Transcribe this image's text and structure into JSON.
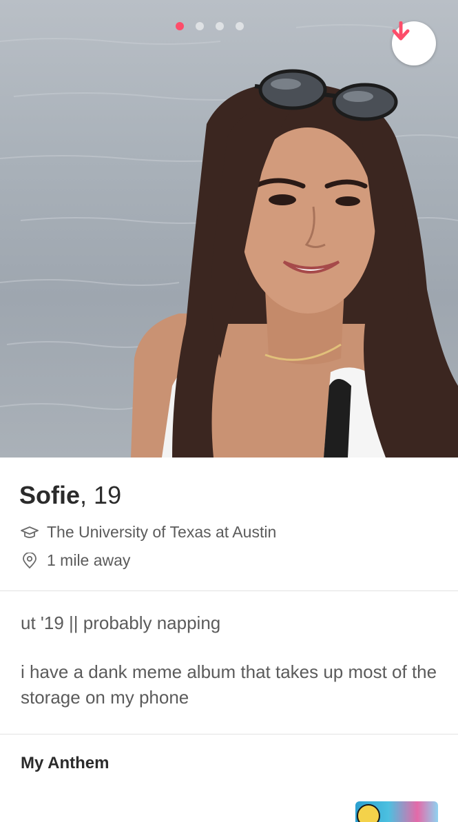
{
  "carousel": {
    "photo_count": 4,
    "active_index": 0
  },
  "colors": {
    "accent": "#fd4d6a",
    "text_dark": "#2b2b2b",
    "text_muted": "#5b5b5b",
    "divider": "#e2e2e2"
  },
  "profile": {
    "name": "Sofie",
    "separator": ",",
    "age": "19",
    "school": "The University of Texas at Austin",
    "distance": "1 mile away"
  },
  "bio": {
    "line1": "ut '19 || probably napping",
    "line2": "i have a dank meme album that takes up most of the storage on my phone"
  },
  "anthem": {
    "title": "My Anthem"
  },
  "icons": {
    "collapse": "arrow-down-icon",
    "school": "graduation-cap-icon",
    "distance": "location-pin-icon"
  }
}
